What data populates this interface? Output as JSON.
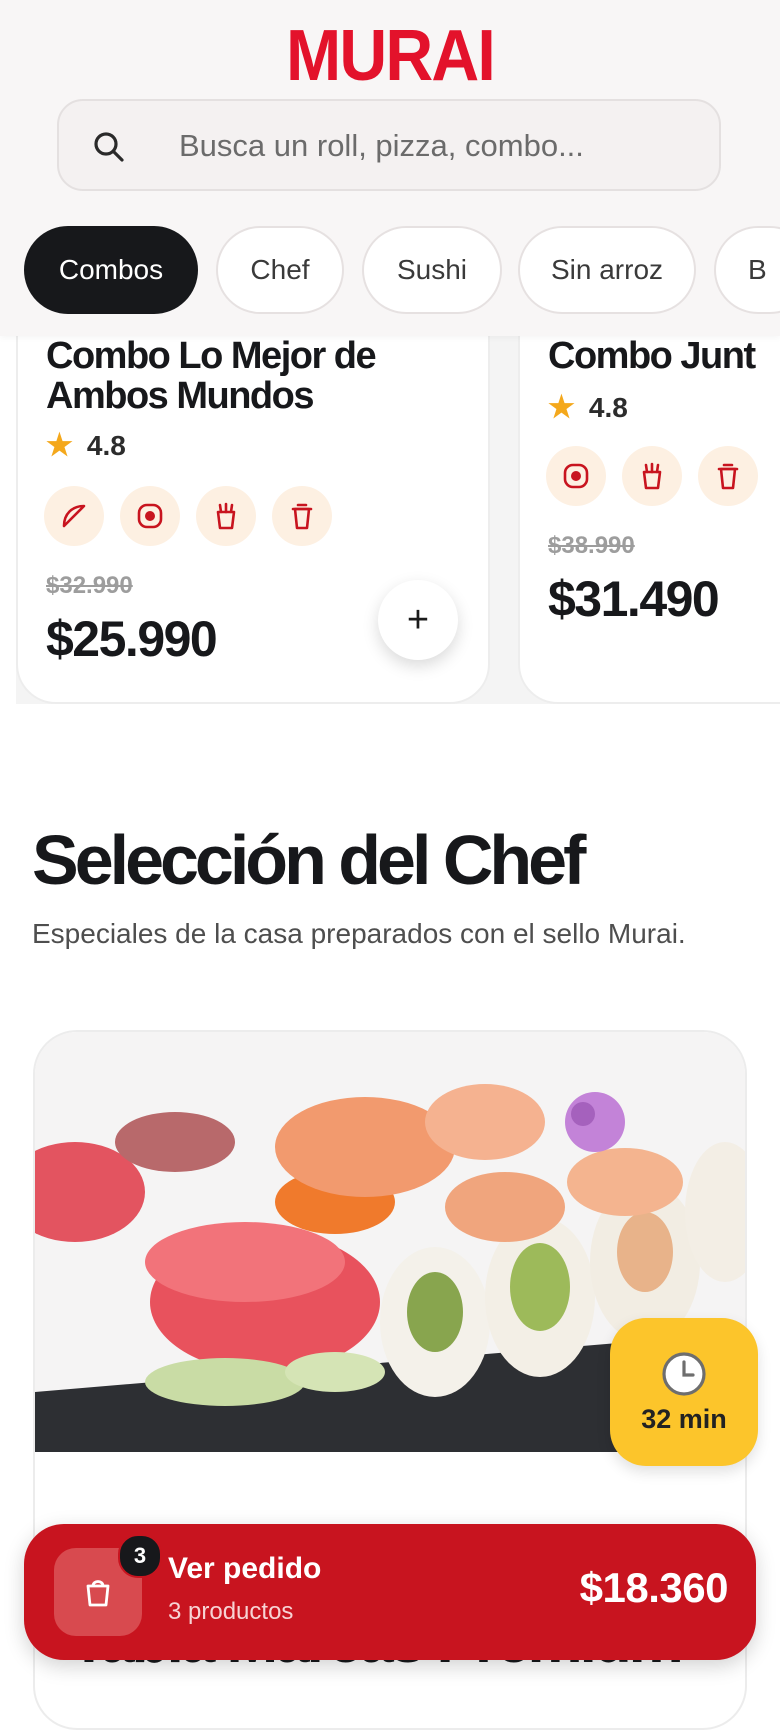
{
  "header": {
    "logo": "MURAI",
    "search_placeholder": "Busca un roll, pizza, combo..."
  },
  "categories": [
    {
      "label": "Combos",
      "active": true
    },
    {
      "label": "Chef",
      "active": false
    },
    {
      "label": "Sushi",
      "active": false
    },
    {
      "label": "Sin arroz",
      "active": false
    },
    {
      "label": "B",
      "active": false
    }
  ],
  "products": [
    {
      "name_line1": "Combo Lo Mejor de",
      "name_line2": "Ambos Mundos",
      "rating": "4.8",
      "tags": [
        "nori-wrap-icon",
        "roll-icon",
        "fries-icon",
        "drink-icon"
      ],
      "old_price": "$32.990",
      "price": "$25.990",
      "add_label": "+"
    },
    {
      "name_line1": "Combo Junt",
      "rating": "4.8",
      "tags": [
        "roll-icon",
        "fries-icon",
        "drink-icon"
      ],
      "old_price": "$38.990",
      "price": "$31.490"
    }
  ],
  "chef_section": {
    "title": "Selección del Chef",
    "subtitle": "Especiales de la casa preparados con el sello Murai.",
    "featured": {
      "name": "Tabla Mareas Premium",
      "time": "32 min"
    }
  },
  "order": {
    "count": "3",
    "title": "Ver pedido",
    "subtitle": "3 productos",
    "total": "$18.360"
  },
  "colors": {
    "brand_red": "#e3122b",
    "order_bar": "#c8141f",
    "dark": "#17181b",
    "star": "#f4a81c",
    "time_badge": "#fcc52b"
  }
}
